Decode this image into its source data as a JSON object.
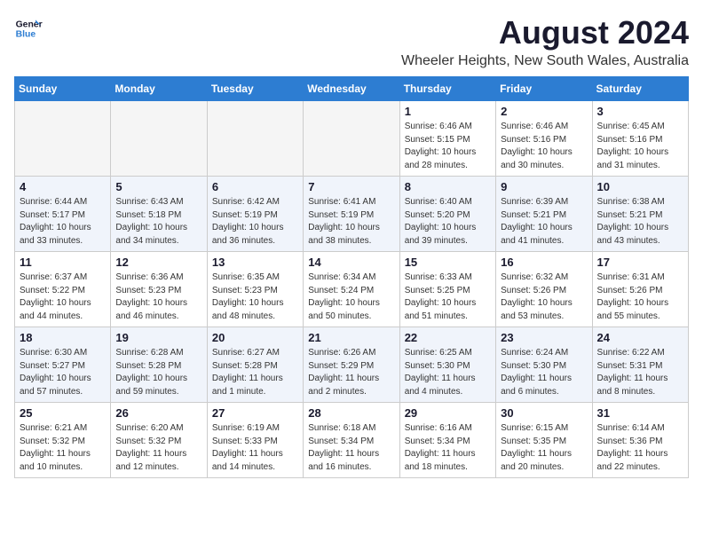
{
  "logo": {
    "line1": "General",
    "line2": "Blue"
  },
  "title": "August 2024",
  "subtitle": "Wheeler Heights, New South Wales, Australia",
  "days_header": [
    "Sunday",
    "Monday",
    "Tuesday",
    "Wednesday",
    "Thursday",
    "Friday",
    "Saturday"
  ],
  "weeks": [
    [
      {
        "day": "",
        "info": ""
      },
      {
        "day": "",
        "info": ""
      },
      {
        "day": "",
        "info": ""
      },
      {
        "day": "",
        "info": ""
      },
      {
        "day": "1",
        "info": "Sunrise: 6:46 AM\nSunset: 5:15 PM\nDaylight: 10 hours\nand 28 minutes."
      },
      {
        "day": "2",
        "info": "Sunrise: 6:46 AM\nSunset: 5:16 PM\nDaylight: 10 hours\nand 30 minutes."
      },
      {
        "day": "3",
        "info": "Sunrise: 6:45 AM\nSunset: 5:16 PM\nDaylight: 10 hours\nand 31 minutes."
      }
    ],
    [
      {
        "day": "4",
        "info": "Sunrise: 6:44 AM\nSunset: 5:17 PM\nDaylight: 10 hours\nand 33 minutes."
      },
      {
        "day": "5",
        "info": "Sunrise: 6:43 AM\nSunset: 5:18 PM\nDaylight: 10 hours\nand 34 minutes."
      },
      {
        "day": "6",
        "info": "Sunrise: 6:42 AM\nSunset: 5:19 PM\nDaylight: 10 hours\nand 36 minutes."
      },
      {
        "day": "7",
        "info": "Sunrise: 6:41 AM\nSunset: 5:19 PM\nDaylight: 10 hours\nand 38 minutes."
      },
      {
        "day": "8",
        "info": "Sunrise: 6:40 AM\nSunset: 5:20 PM\nDaylight: 10 hours\nand 39 minutes."
      },
      {
        "day": "9",
        "info": "Sunrise: 6:39 AM\nSunset: 5:21 PM\nDaylight: 10 hours\nand 41 minutes."
      },
      {
        "day": "10",
        "info": "Sunrise: 6:38 AM\nSunset: 5:21 PM\nDaylight: 10 hours\nand 43 minutes."
      }
    ],
    [
      {
        "day": "11",
        "info": "Sunrise: 6:37 AM\nSunset: 5:22 PM\nDaylight: 10 hours\nand 44 minutes."
      },
      {
        "day": "12",
        "info": "Sunrise: 6:36 AM\nSunset: 5:23 PM\nDaylight: 10 hours\nand 46 minutes."
      },
      {
        "day": "13",
        "info": "Sunrise: 6:35 AM\nSunset: 5:23 PM\nDaylight: 10 hours\nand 48 minutes."
      },
      {
        "day": "14",
        "info": "Sunrise: 6:34 AM\nSunset: 5:24 PM\nDaylight: 10 hours\nand 50 minutes."
      },
      {
        "day": "15",
        "info": "Sunrise: 6:33 AM\nSunset: 5:25 PM\nDaylight: 10 hours\nand 51 minutes."
      },
      {
        "day": "16",
        "info": "Sunrise: 6:32 AM\nSunset: 5:26 PM\nDaylight: 10 hours\nand 53 minutes."
      },
      {
        "day": "17",
        "info": "Sunrise: 6:31 AM\nSunset: 5:26 PM\nDaylight: 10 hours\nand 55 minutes."
      }
    ],
    [
      {
        "day": "18",
        "info": "Sunrise: 6:30 AM\nSunset: 5:27 PM\nDaylight: 10 hours\nand 57 minutes."
      },
      {
        "day": "19",
        "info": "Sunrise: 6:28 AM\nSunset: 5:28 PM\nDaylight: 10 hours\nand 59 minutes."
      },
      {
        "day": "20",
        "info": "Sunrise: 6:27 AM\nSunset: 5:28 PM\nDaylight: 11 hours\nand 1 minute."
      },
      {
        "day": "21",
        "info": "Sunrise: 6:26 AM\nSunset: 5:29 PM\nDaylight: 11 hours\nand 2 minutes."
      },
      {
        "day": "22",
        "info": "Sunrise: 6:25 AM\nSunset: 5:30 PM\nDaylight: 11 hours\nand 4 minutes."
      },
      {
        "day": "23",
        "info": "Sunrise: 6:24 AM\nSunset: 5:30 PM\nDaylight: 11 hours\nand 6 minutes."
      },
      {
        "day": "24",
        "info": "Sunrise: 6:22 AM\nSunset: 5:31 PM\nDaylight: 11 hours\nand 8 minutes."
      }
    ],
    [
      {
        "day": "25",
        "info": "Sunrise: 6:21 AM\nSunset: 5:32 PM\nDaylight: 11 hours\nand 10 minutes."
      },
      {
        "day": "26",
        "info": "Sunrise: 6:20 AM\nSunset: 5:32 PM\nDaylight: 11 hours\nand 12 minutes."
      },
      {
        "day": "27",
        "info": "Sunrise: 6:19 AM\nSunset: 5:33 PM\nDaylight: 11 hours\nand 14 minutes."
      },
      {
        "day": "28",
        "info": "Sunrise: 6:18 AM\nSunset: 5:34 PM\nDaylight: 11 hours\nand 16 minutes."
      },
      {
        "day": "29",
        "info": "Sunrise: 6:16 AM\nSunset: 5:34 PM\nDaylight: 11 hours\nand 18 minutes."
      },
      {
        "day": "30",
        "info": "Sunrise: 6:15 AM\nSunset: 5:35 PM\nDaylight: 11 hours\nand 20 minutes."
      },
      {
        "day": "31",
        "info": "Sunrise: 6:14 AM\nSunset: 5:36 PM\nDaylight: 11 hours\nand 22 minutes."
      }
    ]
  ]
}
